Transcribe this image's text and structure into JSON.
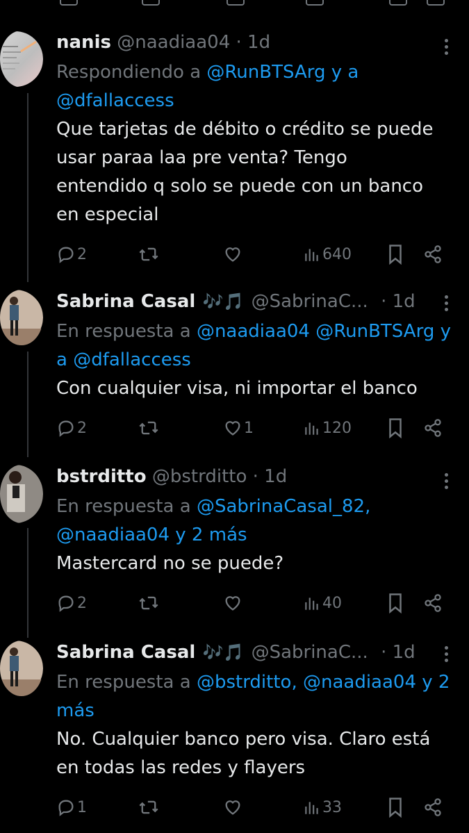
{
  "tweets": [
    {
      "name": "nanis",
      "emoji": "",
      "handle": "@naadiaa04",
      "sep": "·",
      "time": "1d",
      "reply_prefix": "Respondiendo a ",
      "reply_links": "@RunBTSArg y a @dfallaccess",
      "text_lines": [
        "Que tarjetas de débito o crédito se puede",
        "usar paraa laa pre venta? Tengo",
        "entendido q solo se puede con un banco",
        "en especial"
      ],
      "replies": "2",
      "retweets": "",
      "likes": "",
      "views": "640"
    },
    {
      "name": "Sabrina Casal",
      "emoji": "🎶🎵",
      "handle": "@SabrinaC...",
      "sep": "·",
      "time": "1d",
      "reply_prefix": "En respuesta a ",
      "reply_links": "@naadiaa04 @RunBTSArg y a @dfallaccess",
      "text_lines": [
        "Con cualquier visa, ni importar el banco"
      ],
      "replies": "2",
      "retweets": "",
      "likes": "1",
      "views": "120"
    },
    {
      "name": "bstrditto",
      "emoji": "",
      "handle": "@bstrditto",
      "sep": "·",
      "time": "1d",
      "reply_prefix": "En respuesta a ",
      "reply_links": "@SabrinaCasal_82, @naadiaa04 y 2 más",
      "text_lines": [
        "Mastercard no se puede?"
      ],
      "replies": "2",
      "retweets": "",
      "likes": "",
      "views": "40"
    },
    {
      "name": "Sabrina Casal",
      "emoji": "🎶🎵",
      "handle": "@SabrinaC...",
      "sep": "·",
      "time": "1d",
      "reply_prefix": "En respuesta a ",
      "reply_links": "@bstrditto, @naadiaa04 y 2 más",
      "text_lines": [
        "No. Cualquier banco pero visa. Claro está",
        "en todas las redes y flayers"
      ],
      "replies": "1",
      "retweets": "",
      "likes": "",
      "views": "33"
    }
  ],
  "colors": {
    "background": "#000000",
    "text": "#e7e9ea",
    "muted": "#71767b",
    "link": "#1d9bf0"
  }
}
